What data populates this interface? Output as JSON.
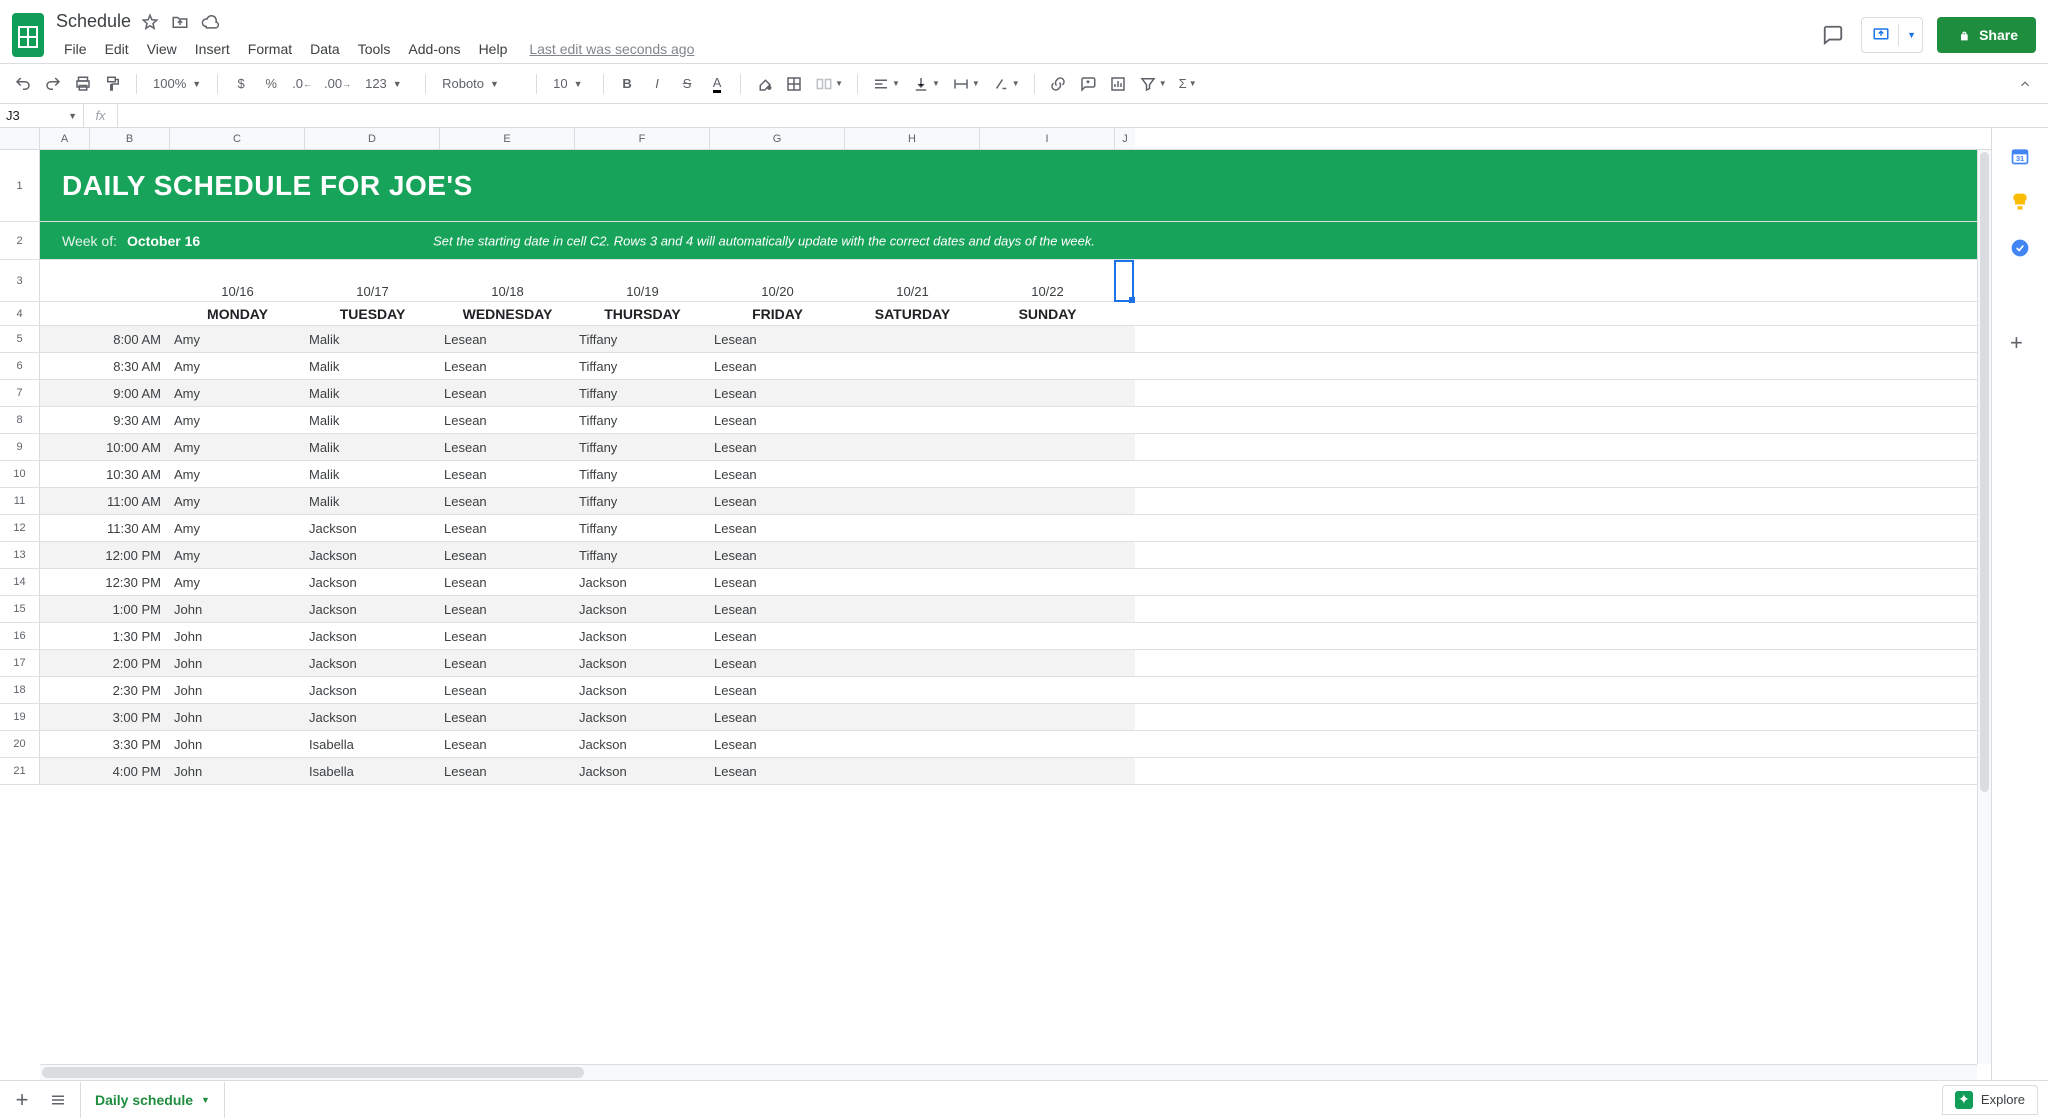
{
  "doc": {
    "title": "Schedule"
  },
  "menus": [
    "File",
    "Edit",
    "View",
    "Insert",
    "Format",
    "Data",
    "Tools",
    "Add-ons",
    "Help"
  ],
  "last_edit": "Last edit was seconds ago",
  "share": {
    "label": "Share"
  },
  "toolbar": {
    "zoom": "100%",
    "more_formats": "123",
    "font": "Roboto",
    "font_size": "10"
  },
  "namebox": "J3",
  "fx_label": "fx",
  "formula": "",
  "columns": [
    "A",
    "B",
    "C",
    "D",
    "E",
    "F",
    "G",
    "H",
    "I",
    "J"
  ],
  "banner": {
    "title": "DAILY SCHEDULE FOR JOE'S",
    "week_label": "Week of:",
    "week_date": "October 16",
    "hint": "Set the starting date in cell C2. Rows 3 and 4 will automatically update with the correct dates and days of the week."
  },
  "dates": [
    "10/16",
    "10/17",
    "10/18",
    "10/19",
    "10/20",
    "10/21",
    "10/22"
  ],
  "days": [
    "MONDAY",
    "TUESDAY",
    "WEDNESDAY",
    "THURSDAY",
    "FRIDAY",
    "SATURDAY",
    "SUNDAY"
  ],
  "schedule": [
    {
      "t": "8:00 AM",
      "c": [
        "Amy",
        "Malik",
        "Lesean",
        "Tiffany",
        "Lesean",
        "",
        ""
      ]
    },
    {
      "t": "8:30 AM",
      "c": [
        "Amy",
        "Malik",
        "Lesean",
        "Tiffany",
        "Lesean",
        "",
        ""
      ]
    },
    {
      "t": "9:00 AM",
      "c": [
        "Amy",
        "Malik",
        "Lesean",
        "Tiffany",
        "Lesean",
        "",
        ""
      ]
    },
    {
      "t": "9:30 AM",
      "c": [
        "Amy",
        "Malik",
        "Lesean",
        "Tiffany",
        "Lesean",
        "",
        ""
      ]
    },
    {
      "t": "10:00 AM",
      "c": [
        "Amy",
        "Malik",
        "Lesean",
        "Tiffany",
        "Lesean",
        "",
        ""
      ]
    },
    {
      "t": "10:30 AM",
      "c": [
        "Amy",
        "Malik",
        "Lesean",
        "Tiffany",
        "Lesean",
        "",
        ""
      ]
    },
    {
      "t": "11:00 AM",
      "c": [
        "Amy",
        "Malik",
        "Lesean",
        "Tiffany",
        "Lesean",
        "",
        ""
      ]
    },
    {
      "t": "11:30 AM",
      "c": [
        "Amy",
        "Jackson",
        "Lesean",
        "Tiffany",
        "Lesean",
        "",
        ""
      ]
    },
    {
      "t": "12:00 PM",
      "c": [
        "Amy",
        "Jackson",
        "Lesean",
        "Tiffany",
        "Lesean",
        "",
        ""
      ]
    },
    {
      "t": "12:30 PM",
      "c": [
        "Amy",
        "Jackson",
        "Lesean",
        "Jackson",
        "Lesean",
        "",
        ""
      ]
    },
    {
      "t": "1:00 PM",
      "c": [
        "John",
        "Jackson",
        "Lesean",
        "Jackson",
        "Lesean",
        "",
        ""
      ]
    },
    {
      "t": "1:30 PM",
      "c": [
        "John",
        "Jackson",
        "Lesean",
        "Jackson",
        "Lesean",
        "",
        ""
      ]
    },
    {
      "t": "2:00 PM",
      "c": [
        "John",
        "Jackson",
        "Lesean",
        "Jackson",
        "Lesean",
        "",
        ""
      ]
    },
    {
      "t": "2:30 PM",
      "c": [
        "John",
        "Jackson",
        "Lesean",
        "Jackson",
        "Lesean",
        "",
        ""
      ]
    },
    {
      "t": "3:00 PM",
      "c": [
        "John",
        "Jackson",
        "Lesean",
        "Jackson",
        "Lesean",
        "",
        ""
      ]
    },
    {
      "t": "3:30 PM",
      "c": [
        "John",
        "Isabella",
        "Lesean",
        "Jackson",
        "Lesean",
        "",
        ""
      ]
    },
    {
      "t": "4:00 PM",
      "c": [
        "John",
        "Isabella",
        "Lesean",
        "Jackson",
        "Lesean",
        "",
        ""
      ]
    }
  ],
  "sheet_tab": "Daily schedule",
  "explore": "Explore"
}
